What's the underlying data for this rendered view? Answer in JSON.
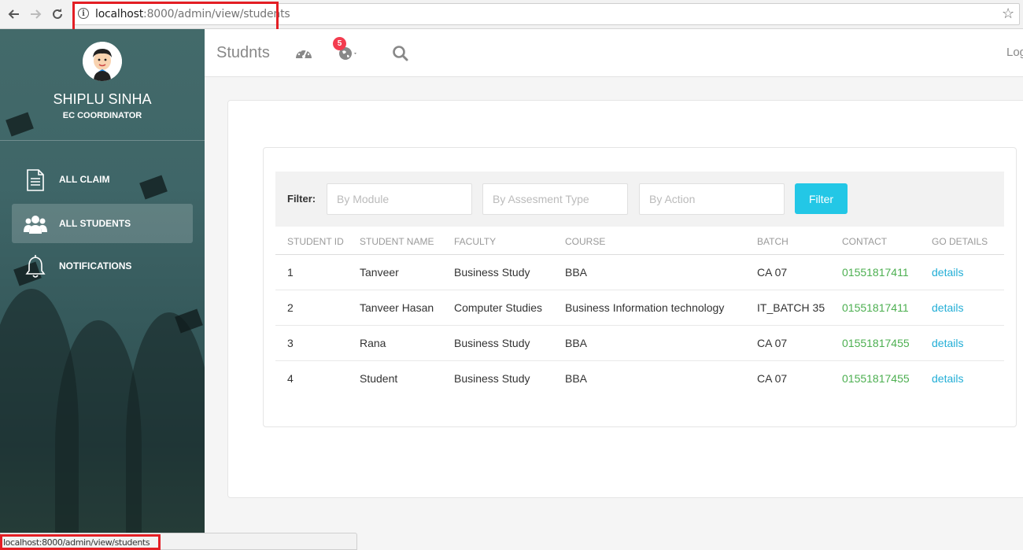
{
  "browser": {
    "url_host": "localhost",
    "url_path": ":8000/admin/view/students"
  },
  "sidebar": {
    "user_name": "SHIPLU SINHA",
    "user_role": "EC COORDINATOR",
    "items": [
      {
        "label": "ALL CLAIM",
        "icon": "document-icon"
      },
      {
        "label": "ALL STUDENTS",
        "icon": "users-icon",
        "active": true
      },
      {
        "label": "NOTIFICATIONS",
        "icon": "bell-icon"
      }
    ]
  },
  "navbar": {
    "brand": "Studnts",
    "notification_count": "5",
    "logout": "Log"
  },
  "filter": {
    "label": "Filter:",
    "module_placeholder": "By Module",
    "assessment_placeholder": "By Assesment Type",
    "action_placeholder": "By Action",
    "button_label": "Filter"
  },
  "table": {
    "headers": [
      "STUDENT ID",
      "STUDENT NAME",
      "FACULTY",
      "COURSE",
      "BATCH",
      "CONTACT",
      "GO DETAILS"
    ],
    "rows": [
      {
        "id": "1",
        "name": "Tanveer",
        "faculty": "Business Study",
        "course": "BBA",
        "batch": "CA 07",
        "contact": "01551817411",
        "details": "details"
      },
      {
        "id": "2",
        "name": "Tanveer Hasan",
        "faculty": "Computer Studies",
        "course": "Business Information technology",
        "batch": "IT_BATCH 35",
        "contact": "01551817411",
        "details": "details"
      },
      {
        "id": "3",
        "name": "Rana",
        "faculty": "Business Study",
        "course": "BBA",
        "batch": "CA 07",
        "contact": "01551817455",
        "details": "details"
      },
      {
        "id": "4",
        "name": "Student",
        "faculty": "Business Study",
        "course": "BBA",
        "batch": "CA 07",
        "contact": "01551817455",
        "details": "details"
      }
    ]
  },
  "status_bar": {
    "text": "localhost:8000/admin/view/students"
  },
  "colors": {
    "accent": "#23c7e6",
    "contact": "#4caf50",
    "link": "#23aed6",
    "badge": "#f33c4f",
    "highlight": "#e31e24"
  }
}
